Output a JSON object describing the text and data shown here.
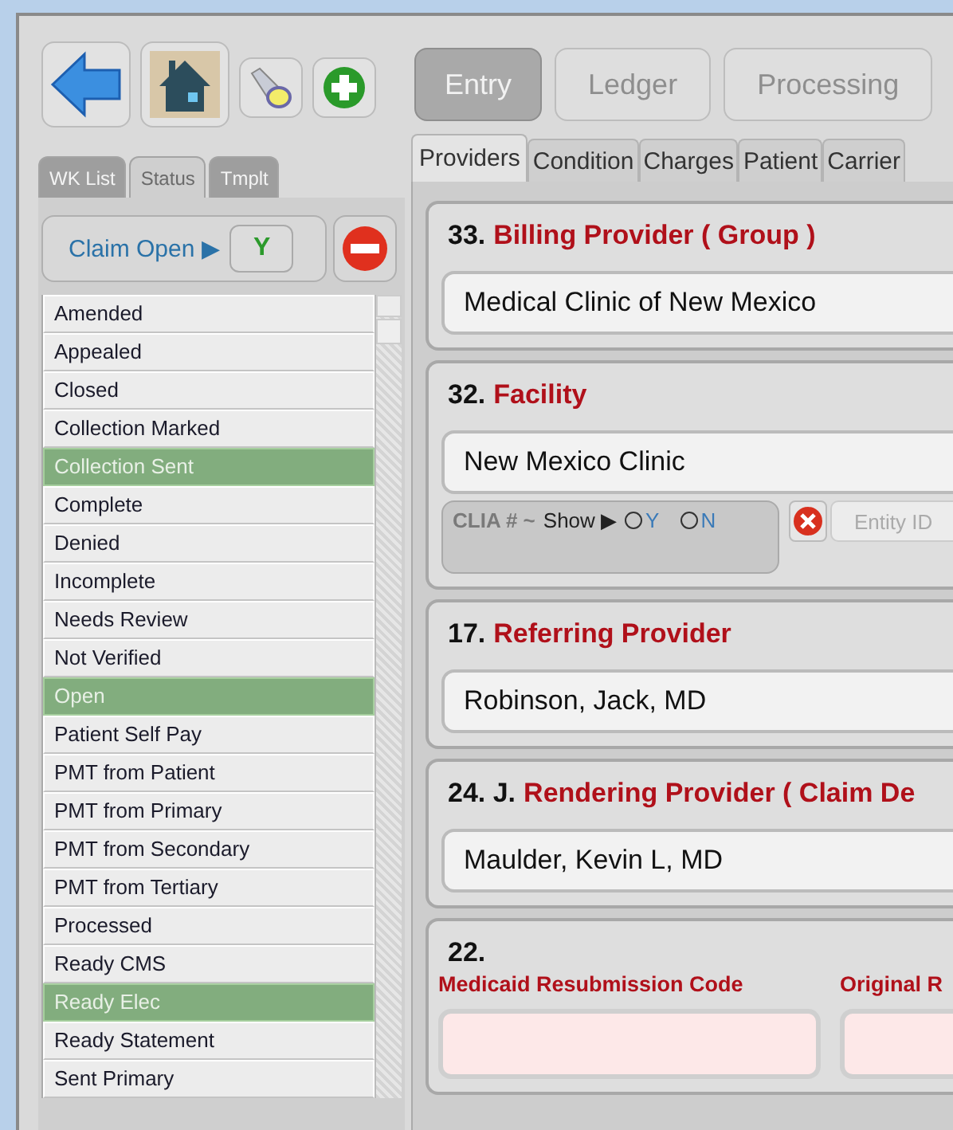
{
  "main_tabs": [
    {
      "label": "Entry",
      "selected": true
    },
    {
      "label": "Ledger",
      "selected": false
    },
    {
      "label": "Processing",
      "selected": false
    }
  ],
  "side_tabs": [
    {
      "label": "WK List",
      "selected": false
    },
    {
      "label": "Status",
      "selected": true
    },
    {
      "label": "Tmplt",
      "selected": false
    }
  ],
  "claim_status": {
    "label": "Claim Open ▶",
    "value": "Y"
  },
  "status_list": [
    {
      "label": "Amended",
      "selected": false
    },
    {
      "label": "Appealed",
      "selected": false
    },
    {
      "label": "Closed",
      "selected": false
    },
    {
      "label": "Collection Marked",
      "selected": false
    },
    {
      "label": "Collection Sent",
      "selected": true
    },
    {
      "label": "Complete",
      "selected": false
    },
    {
      "label": "Denied",
      "selected": false
    },
    {
      "label": "Incomplete",
      "selected": false
    },
    {
      "label": "Needs Review",
      "selected": false
    },
    {
      "label": "Not Verified",
      "selected": false
    },
    {
      "label": "Open",
      "selected": true
    },
    {
      "label": "Patient Self Pay",
      "selected": false
    },
    {
      "label": "PMT from Patient",
      "selected": false
    },
    {
      "label": "PMT from Primary",
      "selected": false
    },
    {
      "label": "PMT from Secondary",
      "selected": false
    },
    {
      "label": "PMT from Tertiary",
      "selected": false
    },
    {
      "label": "Processed",
      "selected": false
    },
    {
      "label": "Ready CMS",
      "selected": false
    },
    {
      "label": "Ready Elec",
      "selected": true
    },
    {
      "label": "Ready Statement",
      "selected": false
    },
    {
      "label": "Sent Primary",
      "selected": false
    }
  ],
  "form_tabs": [
    {
      "label": "Providers",
      "selected": true
    },
    {
      "label": "Condition",
      "selected": false
    },
    {
      "label": "Charges",
      "selected": false
    },
    {
      "label": "Patient",
      "selected": false
    },
    {
      "label": "Carrier",
      "selected": false
    }
  ],
  "sections": [
    {
      "kind": "provider",
      "number": "33.",
      "title": "Billing Provider ( Group )",
      "value": "Medical Clinic of New Mexico"
    },
    {
      "kind": "provider",
      "number": "32.",
      "title": "Facility",
      "value": "New Mexico Clinic",
      "clia": {
        "label": "CLIA # ~",
        "show": "Show ▶",
        "options": [
          {
            "label": "Y",
            "selected": false
          },
          {
            "label": "N",
            "selected": false
          }
        ],
        "placeholder": "Entity ID"
      }
    },
    {
      "kind": "provider",
      "number": "17.",
      "title": "Referring Provider",
      "value": "Robinson, Jack, MD"
    },
    {
      "kind": "provider",
      "number": "24. J.",
      "title": "Rendering Provider ( Claim De",
      "value": "Maulder, Kevin L, MD"
    },
    {
      "kind": "codes",
      "number": "22.",
      "fields": [
        {
          "label": "Medicaid Resubmission Code"
        },
        {
          "label": "Original R"
        }
      ]
    }
  ]
}
